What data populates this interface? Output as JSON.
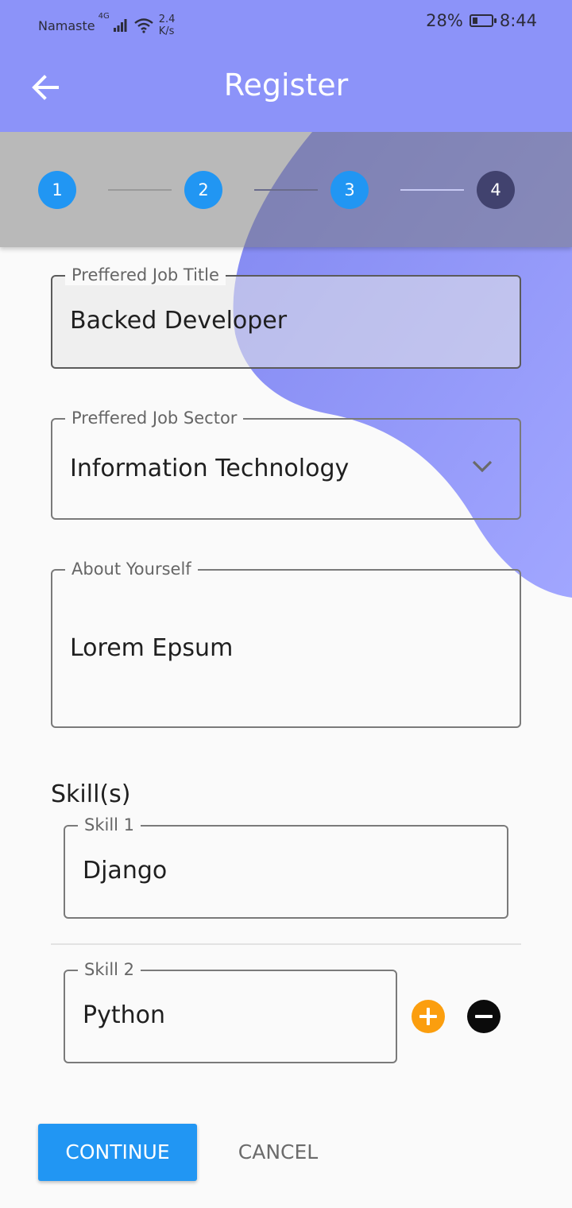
{
  "status_bar": {
    "carrier": "Namaste",
    "network": "4G",
    "speed_value": "2.4",
    "speed_unit": "K/s",
    "battery": "28%",
    "time": "8:44"
  },
  "app_bar": {
    "title": "Register",
    "back_icon": "arrow-left-icon"
  },
  "stepper": {
    "steps": [
      {
        "label": "1",
        "state": "complete"
      },
      {
        "label": "2",
        "state": "complete"
      },
      {
        "label": "3",
        "state": "current"
      },
      {
        "label": "4",
        "state": "upcoming"
      }
    ]
  },
  "form": {
    "job_title": {
      "label": "Preffered Job Title",
      "value": "Backed Developer"
    },
    "job_sector": {
      "label": "Preffered Job Sector",
      "value": "Information Technology",
      "icon": "chevron-down-icon"
    },
    "about": {
      "label": "About Yourself",
      "value": "Lorem Epsum"
    },
    "skills_heading": "Skill(s)",
    "skills": [
      {
        "label": "Skill 1",
        "value": "Django"
      },
      {
        "label": "Skill 2",
        "value": "Python"
      }
    ],
    "add_icon": "plus-circle-icon",
    "remove_icon": "minus-circle-icon"
  },
  "actions": {
    "continue_label": "CONTINUE",
    "cancel_label": "CANCEL"
  },
  "colors": {
    "app_bar": "#8c93f9",
    "step_active": "#2196f3",
    "step_upcoming": "#41426e",
    "add_button": "#fb9e0e",
    "primary_button": "#2196f3"
  }
}
